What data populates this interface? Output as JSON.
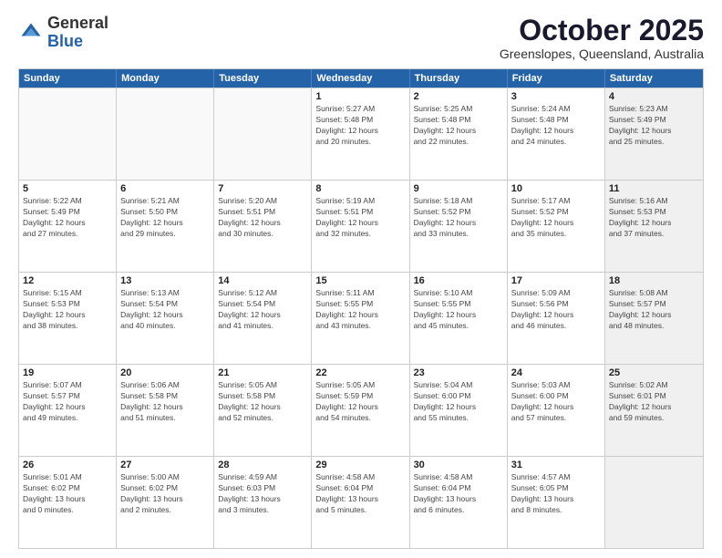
{
  "logo": {
    "general": "General",
    "blue": "Blue"
  },
  "header": {
    "title": "October 2025",
    "subtitle": "Greenslopes, Queensland, Australia"
  },
  "days_of_week": [
    "Sunday",
    "Monday",
    "Tuesday",
    "Wednesday",
    "Thursday",
    "Friday",
    "Saturday"
  ],
  "weeks": [
    [
      {
        "day": "",
        "info": "",
        "empty": true
      },
      {
        "day": "",
        "info": "",
        "empty": true
      },
      {
        "day": "",
        "info": "",
        "empty": true
      },
      {
        "day": "1",
        "info": "Sunrise: 5:27 AM\nSunset: 5:48 PM\nDaylight: 12 hours\nand 20 minutes.",
        "empty": false
      },
      {
        "day": "2",
        "info": "Sunrise: 5:25 AM\nSunset: 5:48 PM\nDaylight: 12 hours\nand 22 minutes.",
        "empty": false
      },
      {
        "day": "3",
        "info": "Sunrise: 5:24 AM\nSunset: 5:48 PM\nDaylight: 12 hours\nand 24 minutes.",
        "empty": false
      },
      {
        "day": "4",
        "info": "Sunrise: 5:23 AM\nSunset: 5:49 PM\nDaylight: 12 hours\nand 25 minutes.",
        "empty": false,
        "shaded": true
      }
    ],
    [
      {
        "day": "5",
        "info": "Sunrise: 5:22 AM\nSunset: 5:49 PM\nDaylight: 12 hours\nand 27 minutes.",
        "empty": false
      },
      {
        "day": "6",
        "info": "Sunrise: 5:21 AM\nSunset: 5:50 PM\nDaylight: 12 hours\nand 29 minutes.",
        "empty": false
      },
      {
        "day": "7",
        "info": "Sunrise: 5:20 AM\nSunset: 5:51 PM\nDaylight: 12 hours\nand 30 minutes.",
        "empty": false
      },
      {
        "day": "8",
        "info": "Sunrise: 5:19 AM\nSunset: 5:51 PM\nDaylight: 12 hours\nand 32 minutes.",
        "empty": false
      },
      {
        "day": "9",
        "info": "Sunrise: 5:18 AM\nSunset: 5:52 PM\nDaylight: 12 hours\nand 33 minutes.",
        "empty": false
      },
      {
        "day": "10",
        "info": "Sunrise: 5:17 AM\nSunset: 5:52 PM\nDaylight: 12 hours\nand 35 minutes.",
        "empty": false
      },
      {
        "day": "11",
        "info": "Sunrise: 5:16 AM\nSunset: 5:53 PM\nDaylight: 12 hours\nand 37 minutes.",
        "empty": false,
        "shaded": true
      }
    ],
    [
      {
        "day": "12",
        "info": "Sunrise: 5:15 AM\nSunset: 5:53 PM\nDaylight: 12 hours\nand 38 minutes.",
        "empty": false
      },
      {
        "day": "13",
        "info": "Sunrise: 5:13 AM\nSunset: 5:54 PM\nDaylight: 12 hours\nand 40 minutes.",
        "empty": false
      },
      {
        "day": "14",
        "info": "Sunrise: 5:12 AM\nSunset: 5:54 PM\nDaylight: 12 hours\nand 41 minutes.",
        "empty": false
      },
      {
        "day": "15",
        "info": "Sunrise: 5:11 AM\nSunset: 5:55 PM\nDaylight: 12 hours\nand 43 minutes.",
        "empty": false
      },
      {
        "day": "16",
        "info": "Sunrise: 5:10 AM\nSunset: 5:55 PM\nDaylight: 12 hours\nand 45 minutes.",
        "empty": false
      },
      {
        "day": "17",
        "info": "Sunrise: 5:09 AM\nSunset: 5:56 PM\nDaylight: 12 hours\nand 46 minutes.",
        "empty": false
      },
      {
        "day": "18",
        "info": "Sunrise: 5:08 AM\nSunset: 5:57 PM\nDaylight: 12 hours\nand 48 minutes.",
        "empty": false,
        "shaded": true
      }
    ],
    [
      {
        "day": "19",
        "info": "Sunrise: 5:07 AM\nSunset: 5:57 PM\nDaylight: 12 hours\nand 49 minutes.",
        "empty": false
      },
      {
        "day": "20",
        "info": "Sunrise: 5:06 AM\nSunset: 5:58 PM\nDaylight: 12 hours\nand 51 minutes.",
        "empty": false
      },
      {
        "day": "21",
        "info": "Sunrise: 5:05 AM\nSunset: 5:58 PM\nDaylight: 12 hours\nand 52 minutes.",
        "empty": false
      },
      {
        "day": "22",
        "info": "Sunrise: 5:05 AM\nSunset: 5:59 PM\nDaylight: 12 hours\nand 54 minutes.",
        "empty": false
      },
      {
        "day": "23",
        "info": "Sunrise: 5:04 AM\nSunset: 6:00 PM\nDaylight: 12 hours\nand 55 minutes.",
        "empty": false
      },
      {
        "day": "24",
        "info": "Sunrise: 5:03 AM\nSunset: 6:00 PM\nDaylight: 12 hours\nand 57 minutes.",
        "empty": false
      },
      {
        "day": "25",
        "info": "Sunrise: 5:02 AM\nSunset: 6:01 PM\nDaylight: 12 hours\nand 59 minutes.",
        "empty": false,
        "shaded": true
      }
    ],
    [
      {
        "day": "26",
        "info": "Sunrise: 5:01 AM\nSunset: 6:02 PM\nDaylight: 13 hours\nand 0 minutes.",
        "empty": false
      },
      {
        "day": "27",
        "info": "Sunrise: 5:00 AM\nSunset: 6:02 PM\nDaylight: 13 hours\nand 2 minutes.",
        "empty": false
      },
      {
        "day": "28",
        "info": "Sunrise: 4:59 AM\nSunset: 6:03 PM\nDaylight: 13 hours\nand 3 minutes.",
        "empty": false
      },
      {
        "day": "29",
        "info": "Sunrise: 4:58 AM\nSunset: 6:04 PM\nDaylight: 13 hours\nand 5 minutes.",
        "empty": false
      },
      {
        "day": "30",
        "info": "Sunrise: 4:58 AM\nSunset: 6:04 PM\nDaylight: 13 hours\nand 6 minutes.",
        "empty": false
      },
      {
        "day": "31",
        "info": "Sunrise: 4:57 AM\nSunset: 6:05 PM\nDaylight: 13 hours\nand 8 minutes.",
        "empty": false
      },
      {
        "day": "",
        "info": "",
        "empty": true,
        "shaded": true
      }
    ]
  ]
}
